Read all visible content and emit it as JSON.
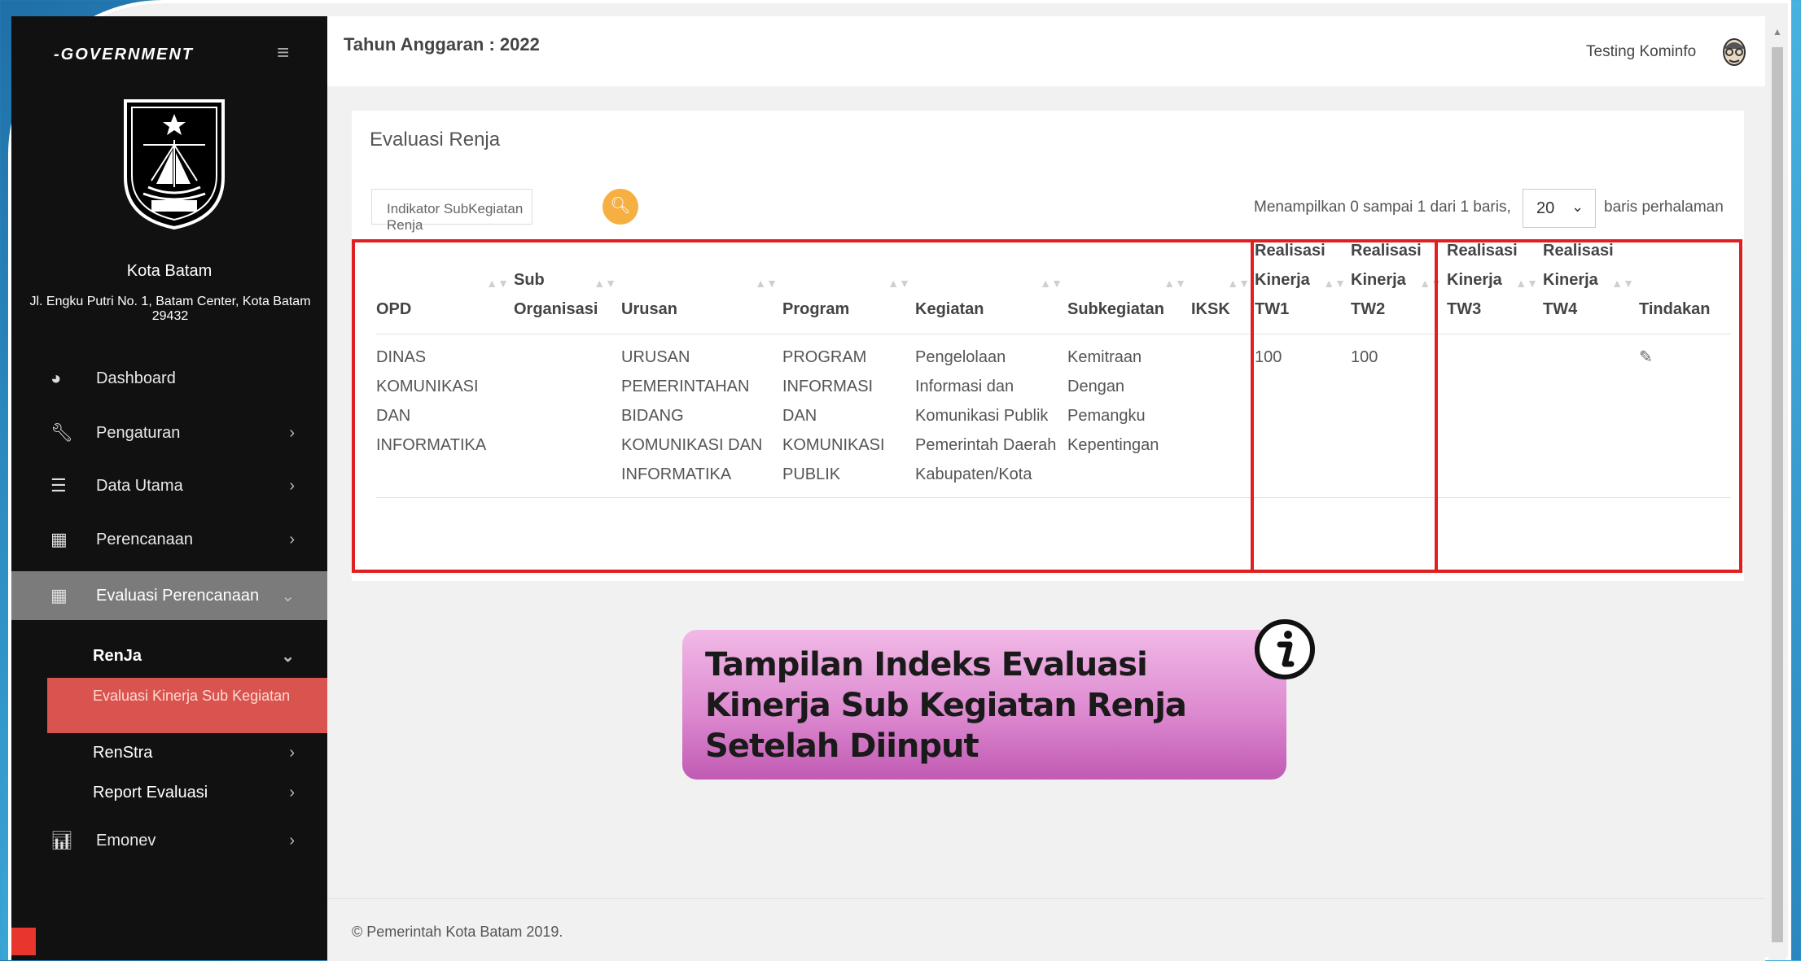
{
  "app": {
    "logo_text": "-GOVERNMENT",
    "city_name": "Kota Batam",
    "city_address": "Jl. Engku Putri No. 1, Batam Center, Kota Batam 29432",
    "crest_label": "BATAM"
  },
  "topbar": {
    "tahun_label": "Tahun Anggaran : 2022",
    "user_name": "Testing Kominfo"
  },
  "sidebar": {
    "items": [
      {
        "label": "Dashboard",
        "icon": "pie-chart-icon"
      },
      {
        "label": "Pengaturan",
        "icon": "wrench-icon"
      },
      {
        "label": "Data Utama",
        "icon": "database-icon"
      },
      {
        "label": "Perencanaan",
        "icon": "calendar-icon"
      },
      {
        "label": "Evaluasi Perencanaan",
        "icon": "grid-icon"
      }
    ],
    "sub_items": {
      "renja": "RenJa",
      "evaluasi_kinerja": "Evaluasi Kinerja Sub Kegiatan",
      "renstra": "RenStra",
      "report": "Report Evaluasi"
    },
    "emonev": {
      "label": "Emonev",
      "icon": "bar-chart-icon"
    }
  },
  "card": {
    "title": "Evaluasi Renja",
    "search_placeholder": "Indikator SubKegiatan Renja",
    "showing_text": "Menampilkan 0 sampai 1 dari 1 baris,",
    "per_page_value": "20",
    "per_page_label": "baris perhalaman"
  },
  "table": {
    "headers": {
      "opd": "OPD",
      "sub_org": "Sub Organisasi",
      "urusan": "Urusan",
      "program": "Program",
      "kegiatan": "Kegiatan",
      "subkegiatan": "Subkegiatan",
      "iksk": "IKSK",
      "tw1": "Realisasi Kinerja TW1",
      "tw2": "Realisasi Kinerja TW2",
      "tw3": "Realisasi Kinerja TW3",
      "tw4": "Realisasi Kinerja TW4",
      "tindakan": "Tindakan"
    },
    "rows": [
      {
        "opd": "DINAS KOMUNIKASI DAN INFORMATIKA",
        "sub_org": "",
        "urusan": "URUSAN PEMERINTAHAN BIDANG KOMUNIKASI DAN INFORMATIKA",
        "program": "PROGRAM INFORMASI DAN KOMUNIKASI PUBLIK",
        "kegiatan": "Pengelolaan Informasi dan Komunikasi Publik Pemerintah Daerah Kabupaten/Kota",
        "subkegiatan": "Kemitraan Dengan Pemangku Kepentingan",
        "iksk": "",
        "tw1": "100",
        "tw2": "100",
        "tw3": "",
        "tw4": ""
      }
    ]
  },
  "callout": {
    "text": "Tampilan Indeks Evaluasi Kinerja Sub Kegiatan Renja Setelah Diinput"
  },
  "footer": {
    "text": "© Pemerintah Kota Batam 2019."
  }
}
